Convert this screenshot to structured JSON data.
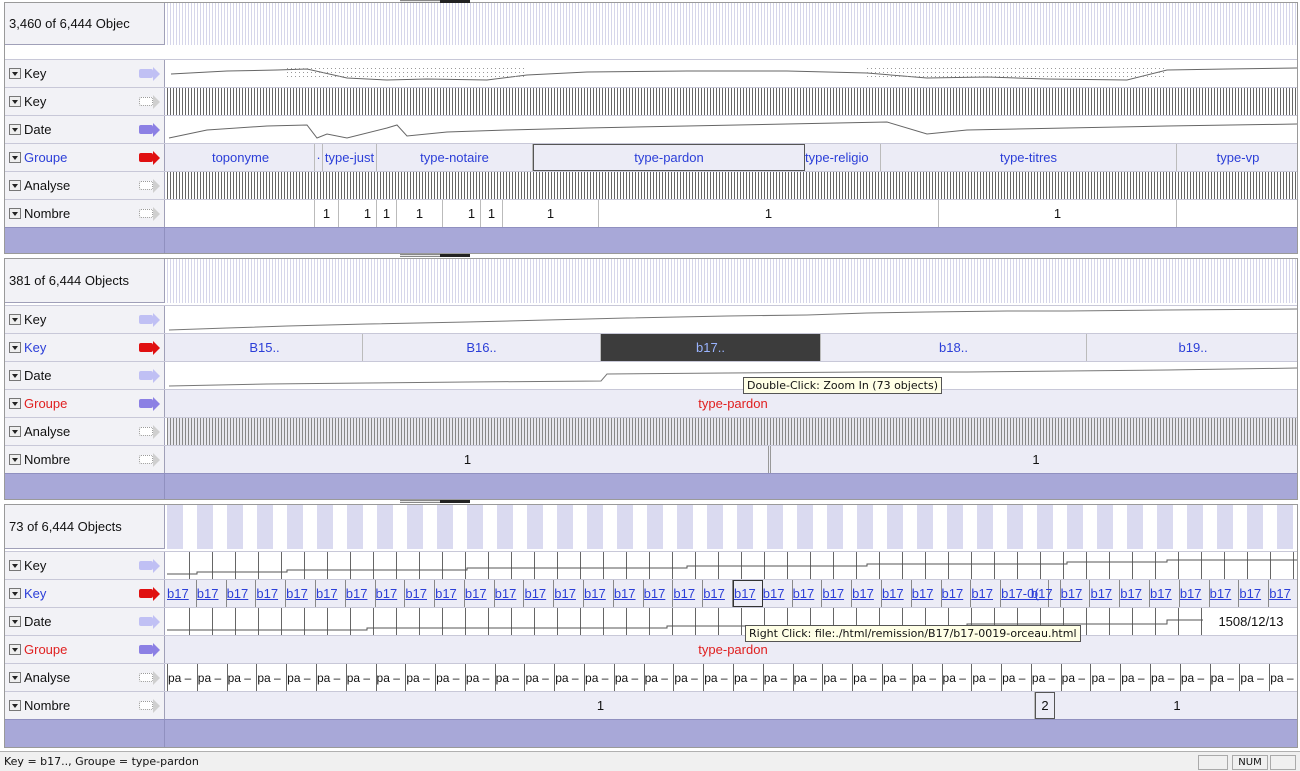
{
  "panels": [
    {
      "count": "3,460 of 6,444 Objec",
      "rows": [
        {
          "name": "Key",
          "arrow": "blue",
          "red": false
        },
        {
          "name": "Key",
          "arrow": "gray",
          "red": false
        },
        {
          "name": "Date",
          "arrow": "purple",
          "red": false
        },
        {
          "name": "Groupe",
          "arrow": "red",
          "red": false
        },
        {
          "name": "Analyse",
          "arrow": "gray",
          "red": false
        },
        {
          "name": "Nombre",
          "arrow": "gray",
          "red": false
        }
      ],
      "groupe_cells": [
        "toponyme",
        "·",
        "type-just",
        "type-notaire",
        "type-pardon",
        "type-religio",
        "type-titres",
        "type-vp"
      ],
      "nombre_cells": [
        "1",
        "1",
        "1",
        "1",
        "1",
        "1",
        "1",
        "1",
        "1"
      ]
    },
    {
      "count": "381 of 6,444 Objects",
      "rows": [
        {
          "name": "Key",
          "arrow": "blue",
          "red": false
        },
        {
          "name": "Key",
          "arrow": "red",
          "red": false
        },
        {
          "name": "Date",
          "arrow": "blue",
          "red": false
        },
        {
          "name": "Groupe",
          "arrow": "purple",
          "red": true
        },
        {
          "name": "Analyse",
          "arrow": "gray",
          "red": false
        },
        {
          "name": "Nombre",
          "arrow": "gray",
          "red": false
        }
      ],
      "key_cells": [
        "B15..",
        "B16..",
        "b17..",
        "b18..",
        "b19.."
      ],
      "groupe_value": "type-pardon",
      "nombre_cells": [
        "1",
        "1"
      ],
      "tooltip": "Double-Click: Zoom In (73 objects)"
    },
    {
      "count": "73 of 6,444 Objects",
      "rows": [
        {
          "name": "Key",
          "arrow": "blue",
          "red": false
        },
        {
          "name": "Key",
          "arrow": "red",
          "red": false
        },
        {
          "name": "Date",
          "arrow": "blue",
          "red": false
        },
        {
          "name": "Groupe",
          "arrow": "purple",
          "red": true
        },
        {
          "name": "Analyse",
          "arrow": "gray",
          "red": false
        },
        {
          "name": "Nombre",
          "arrow": "gray",
          "red": false
        }
      ],
      "key_cell_text": "b17",
      "key_cell_special": "b17-0(",
      "date_value": "1508/12/13",
      "groupe_value": "type-pardon",
      "analyse_cell_text": "pa",
      "nombre_cells": [
        "1",
        "2",
        "1"
      ],
      "tooltip": "Right Click: file:./html/remission/B17/b17-0019-orceau.html"
    }
  ],
  "status": {
    "text": "Key = b17.., Groupe = type-pardon",
    "num": "NUM"
  }
}
